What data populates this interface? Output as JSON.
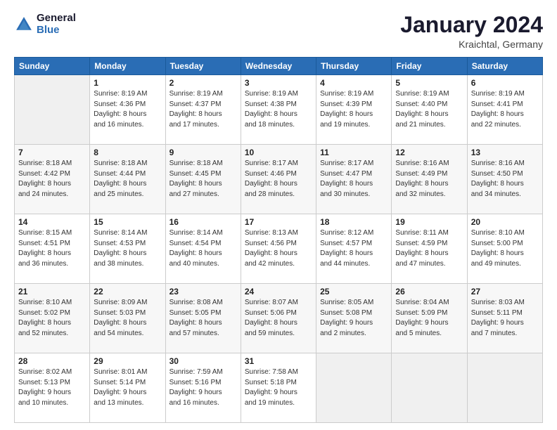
{
  "header": {
    "logo_line1": "General",
    "logo_line2": "Blue",
    "title": "January 2024",
    "subtitle": "Kraichtal, Germany"
  },
  "calendar": {
    "days_of_week": [
      "Sunday",
      "Monday",
      "Tuesday",
      "Wednesday",
      "Thursday",
      "Friday",
      "Saturday"
    ],
    "weeks": [
      [
        {
          "day": "",
          "info": ""
        },
        {
          "day": "1",
          "info": "Sunrise: 8:19 AM\nSunset: 4:36 PM\nDaylight: 8 hours\nand 16 minutes."
        },
        {
          "day": "2",
          "info": "Sunrise: 8:19 AM\nSunset: 4:37 PM\nDaylight: 8 hours\nand 17 minutes."
        },
        {
          "day": "3",
          "info": "Sunrise: 8:19 AM\nSunset: 4:38 PM\nDaylight: 8 hours\nand 18 minutes."
        },
        {
          "day": "4",
          "info": "Sunrise: 8:19 AM\nSunset: 4:39 PM\nDaylight: 8 hours\nand 19 minutes."
        },
        {
          "day": "5",
          "info": "Sunrise: 8:19 AM\nSunset: 4:40 PM\nDaylight: 8 hours\nand 21 minutes."
        },
        {
          "day": "6",
          "info": "Sunrise: 8:19 AM\nSunset: 4:41 PM\nDaylight: 8 hours\nand 22 minutes."
        }
      ],
      [
        {
          "day": "7",
          "info": "Sunrise: 8:18 AM\nSunset: 4:42 PM\nDaylight: 8 hours\nand 24 minutes."
        },
        {
          "day": "8",
          "info": "Sunrise: 8:18 AM\nSunset: 4:44 PM\nDaylight: 8 hours\nand 25 minutes."
        },
        {
          "day": "9",
          "info": "Sunrise: 8:18 AM\nSunset: 4:45 PM\nDaylight: 8 hours\nand 27 minutes."
        },
        {
          "day": "10",
          "info": "Sunrise: 8:17 AM\nSunset: 4:46 PM\nDaylight: 8 hours\nand 28 minutes."
        },
        {
          "day": "11",
          "info": "Sunrise: 8:17 AM\nSunset: 4:47 PM\nDaylight: 8 hours\nand 30 minutes."
        },
        {
          "day": "12",
          "info": "Sunrise: 8:16 AM\nSunset: 4:49 PM\nDaylight: 8 hours\nand 32 minutes."
        },
        {
          "day": "13",
          "info": "Sunrise: 8:16 AM\nSunset: 4:50 PM\nDaylight: 8 hours\nand 34 minutes."
        }
      ],
      [
        {
          "day": "14",
          "info": "Sunrise: 8:15 AM\nSunset: 4:51 PM\nDaylight: 8 hours\nand 36 minutes."
        },
        {
          "day": "15",
          "info": "Sunrise: 8:14 AM\nSunset: 4:53 PM\nDaylight: 8 hours\nand 38 minutes."
        },
        {
          "day": "16",
          "info": "Sunrise: 8:14 AM\nSunset: 4:54 PM\nDaylight: 8 hours\nand 40 minutes."
        },
        {
          "day": "17",
          "info": "Sunrise: 8:13 AM\nSunset: 4:56 PM\nDaylight: 8 hours\nand 42 minutes."
        },
        {
          "day": "18",
          "info": "Sunrise: 8:12 AM\nSunset: 4:57 PM\nDaylight: 8 hours\nand 44 minutes."
        },
        {
          "day": "19",
          "info": "Sunrise: 8:11 AM\nSunset: 4:59 PM\nDaylight: 8 hours\nand 47 minutes."
        },
        {
          "day": "20",
          "info": "Sunrise: 8:10 AM\nSunset: 5:00 PM\nDaylight: 8 hours\nand 49 minutes."
        }
      ],
      [
        {
          "day": "21",
          "info": "Sunrise: 8:10 AM\nSunset: 5:02 PM\nDaylight: 8 hours\nand 52 minutes."
        },
        {
          "day": "22",
          "info": "Sunrise: 8:09 AM\nSunset: 5:03 PM\nDaylight: 8 hours\nand 54 minutes."
        },
        {
          "day": "23",
          "info": "Sunrise: 8:08 AM\nSunset: 5:05 PM\nDaylight: 8 hours\nand 57 minutes."
        },
        {
          "day": "24",
          "info": "Sunrise: 8:07 AM\nSunset: 5:06 PM\nDaylight: 8 hours\nand 59 minutes."
        },
        {
          "day": "25",
          "info": "Sunrise: 8:05 AM\nSunset: 5:08 PM\nDaylight: 9 hours\nand 2 minutes."
        },
        {
          "day": "26",
          "info": "Sunrise: 8:04 AM\nSunset: 5:09 PM\nDaylight: 9 hours\nand 5 minutes."
        },
        {
          "day": "27",
          "info": "Sunrise: 8:03 AM\nSunset: 5:11 PM\nDaylight: 9 hours\nand 7 minutes."
        }
      ],
      [
        {
          "day": "28",
          "info": "Sunrise: 8:02 AM\nSunset: 5:13 PM\nDaylight: 9 hours\nand 10 minutes."
        },
        {
          "day": "29",
          "info": "Sunrise: 8:01 AM\nSunset: 5:14 PM\nDaylight: 9 hours\nand 13 minutes."
        },
        {
          "day": "30",
          "info": "Sunrise: 7:59 AM\nSunset: 5:16 PM\nDaylight: 9 hours\nand 16 minutes."
        },
        {
          "day": "31",
          "info": "Sunrise: 7:58 AM\nSunset: 5:18 PM\nDaylight: 9 hours\nand 19 minutes."
        },
        {
          "day": "",
          "info": ""
        },
        {
          "day": "",
          "info": ""
        },
        {
          "day": "",
          "info": ""
        }
      ]
    ]
  }
}
